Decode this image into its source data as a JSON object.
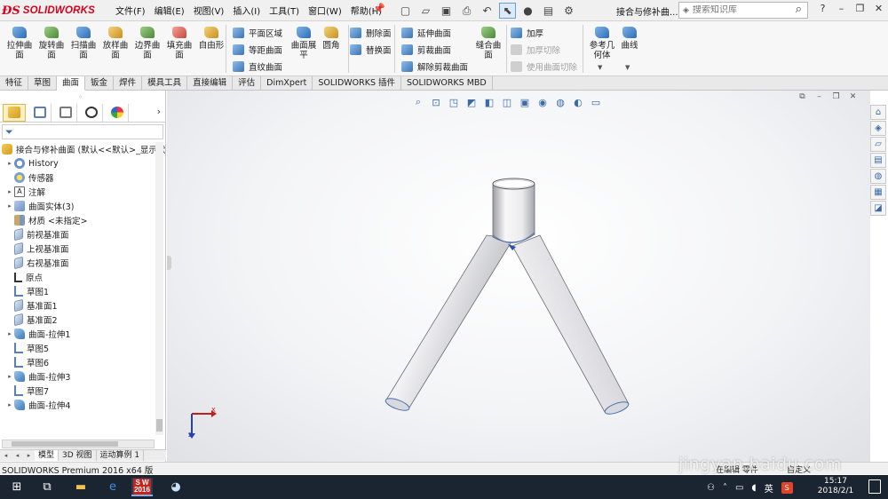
{
  "app": {
    "brand": "SOLIDWORKS",
    "doc_title": "接合与修补曲...",
    "menus": [
      "文件(F)",
      "编辑(E)",
      "视图(V)",
      "插入(I)",
      "工具(T)",
      "窗口(W)",
      "帮助(H)"
    ],
    "search_placeholder": "搜索知识库"
  },
  "toolbar": {
    "big_buttons": [
      {
        "label": "拉伸曲\n面",
        "icon": "extruded-surface-icon"
      },
      {
        "label": "旋转曲\n面",
        "icon": "revolved-surface-icon"
      },
      {
        "label": "扫描曲\n面",
        "icon": "swept-surface-icon"
      },
      {
        "label": "放样曲\n面",
        "icon": "lofted-surface-icon"
      },
      {
        "label": "边界曲\n面",
        "icon": "boundary-surface-icon"
      },
      {
        "label": "填充曲\n面",
        "icon": "filled-surface-icon"
      },
      {
        "label": "自由形",
        "icon": "freeform-icon"
      }
    ],
    "col2": [
      "平面区域",
      "等距曲面",
      "直纹曲面"
    ],
    "big2": [
      {
        "label": "曲面展\n平"
      },
      {
        "label": "圆角"
      }
    ],
    "col3": [
      "删除面",
      "替换面"
    ],
    "col4": [
      "延伸曲面",
      "剪裁曲面",
      "解除剪裁曲面"
    ],
    "big3": [
      {
        "label": "缝合曲\n面"
      }
    ],
    "col5": [
      {
        "label": "加厚",
        "enabled": true
      },
      {
        "label": "加厚切除",
        "enabled": false
      },
      {
        "label": "使用曲面切除",
        "enabled": false
      }
    ],
    "big4": [
      {
        "label": "参考几\n何体"
      },
      {
        "label": "曲线"
      }
    ]
  },
  "tabs": [
    "特征",
    "草图",
    "曲面",
    "钣金",
    "焊件",
    "模具工具",
    "直接编辑",
    "评估",
    "DimXpert",
    "SOLIDWORKS 插件",
    "SOLIDWORKS MBD"
  ],
  "active_tab": "曲面",
  "tree": {
    "root": "接合与修补曲面  (默认<<默认>_显示状",
    "items": [
      {
        "label": "History",
        "icon": "history-icon",
        "expandable": true
      },
      {
        "label": "传感器",
        "icon": "sensor-icon",
        "expandable": false
      },
      {
        "label": "注解",
        "icon": "annotation-icon",
        "expandable": true
      },
      {
        "label": "曲面实体(3)",
        "icon": "surface-bodies-icon",
        "expandable": true
      },
      {
        "label": "材质 <未指定>",
        "icon": "material-icon",
        "expandable": false
      },
      {
        "label": "前视基准面",
        "icon": "plane-icon",
        "expandable": false
      },
      {
        "label": "上视基准面",
        "icon": "plane-icon",
        "expandable": false
      },
      {
        "label": "右视基准面",
        "icon": "plane-icon",
        "expandable": false
      },
      {
        "label": "原点",
        "icon": "origin-icon",
        "expandable": false
      },
      {
        "label": "草图1",
        "icon": "sketch-icon",
        "expandable": false
      },
      {
        "label": "基准面1",
        "icon": "plane-icon",
        "expandable": false
      },
      {
        "label": "基准面2",
        "icon": "plane-icon",
        "expandable": false
      },
      {
        "label": "曲面-拉伸1",
        "icon": "extruded-surface-icon",
        "expandable": true
      },
      {
        "label": "草图5",
        "icon": "sketch-icon",
        "expandable": false
      },
      {
        "label": "草图6",
        "icon": "sketch-icon",
        "expandable": false
      },
      {
        "label": "曲面-拉伸3",
        "icon": "extruded-surface-icon",
        "expandable": true
      },
      {
        "label": "草图7",
        "icon": "sketch-icon",
        "expandable": false
      },
      {
        "label": "曲面-拉伸4",
        "icon": "extruded-surface-icon",
        "expandable": true
      }
    ]
  },
  "bottom_tabs": [
    "模型",
    "3D 视图",
    "运动算例 1"
  ],
  "status": {
    "left": "SOLIDWORKS Premium 2016 x64 版",
    "mid": "在编辑 零件",
    "right": "自定义"
  },
  "taskbar": {
    "time": "15:17",
    "date": "2018/2/1",
    "ime": "英",
    "sw_badge": "S W\n2016"
  },
  "watermark": "jingyan.baidu.com",
  "triad": {
    "x": "X",
    "z": "Z"
  },
  "colors": {
    "brand": "#d6001c",
    "accent": "#2d6cb5",
    "taskbar": "#1b2431"
  }
}
